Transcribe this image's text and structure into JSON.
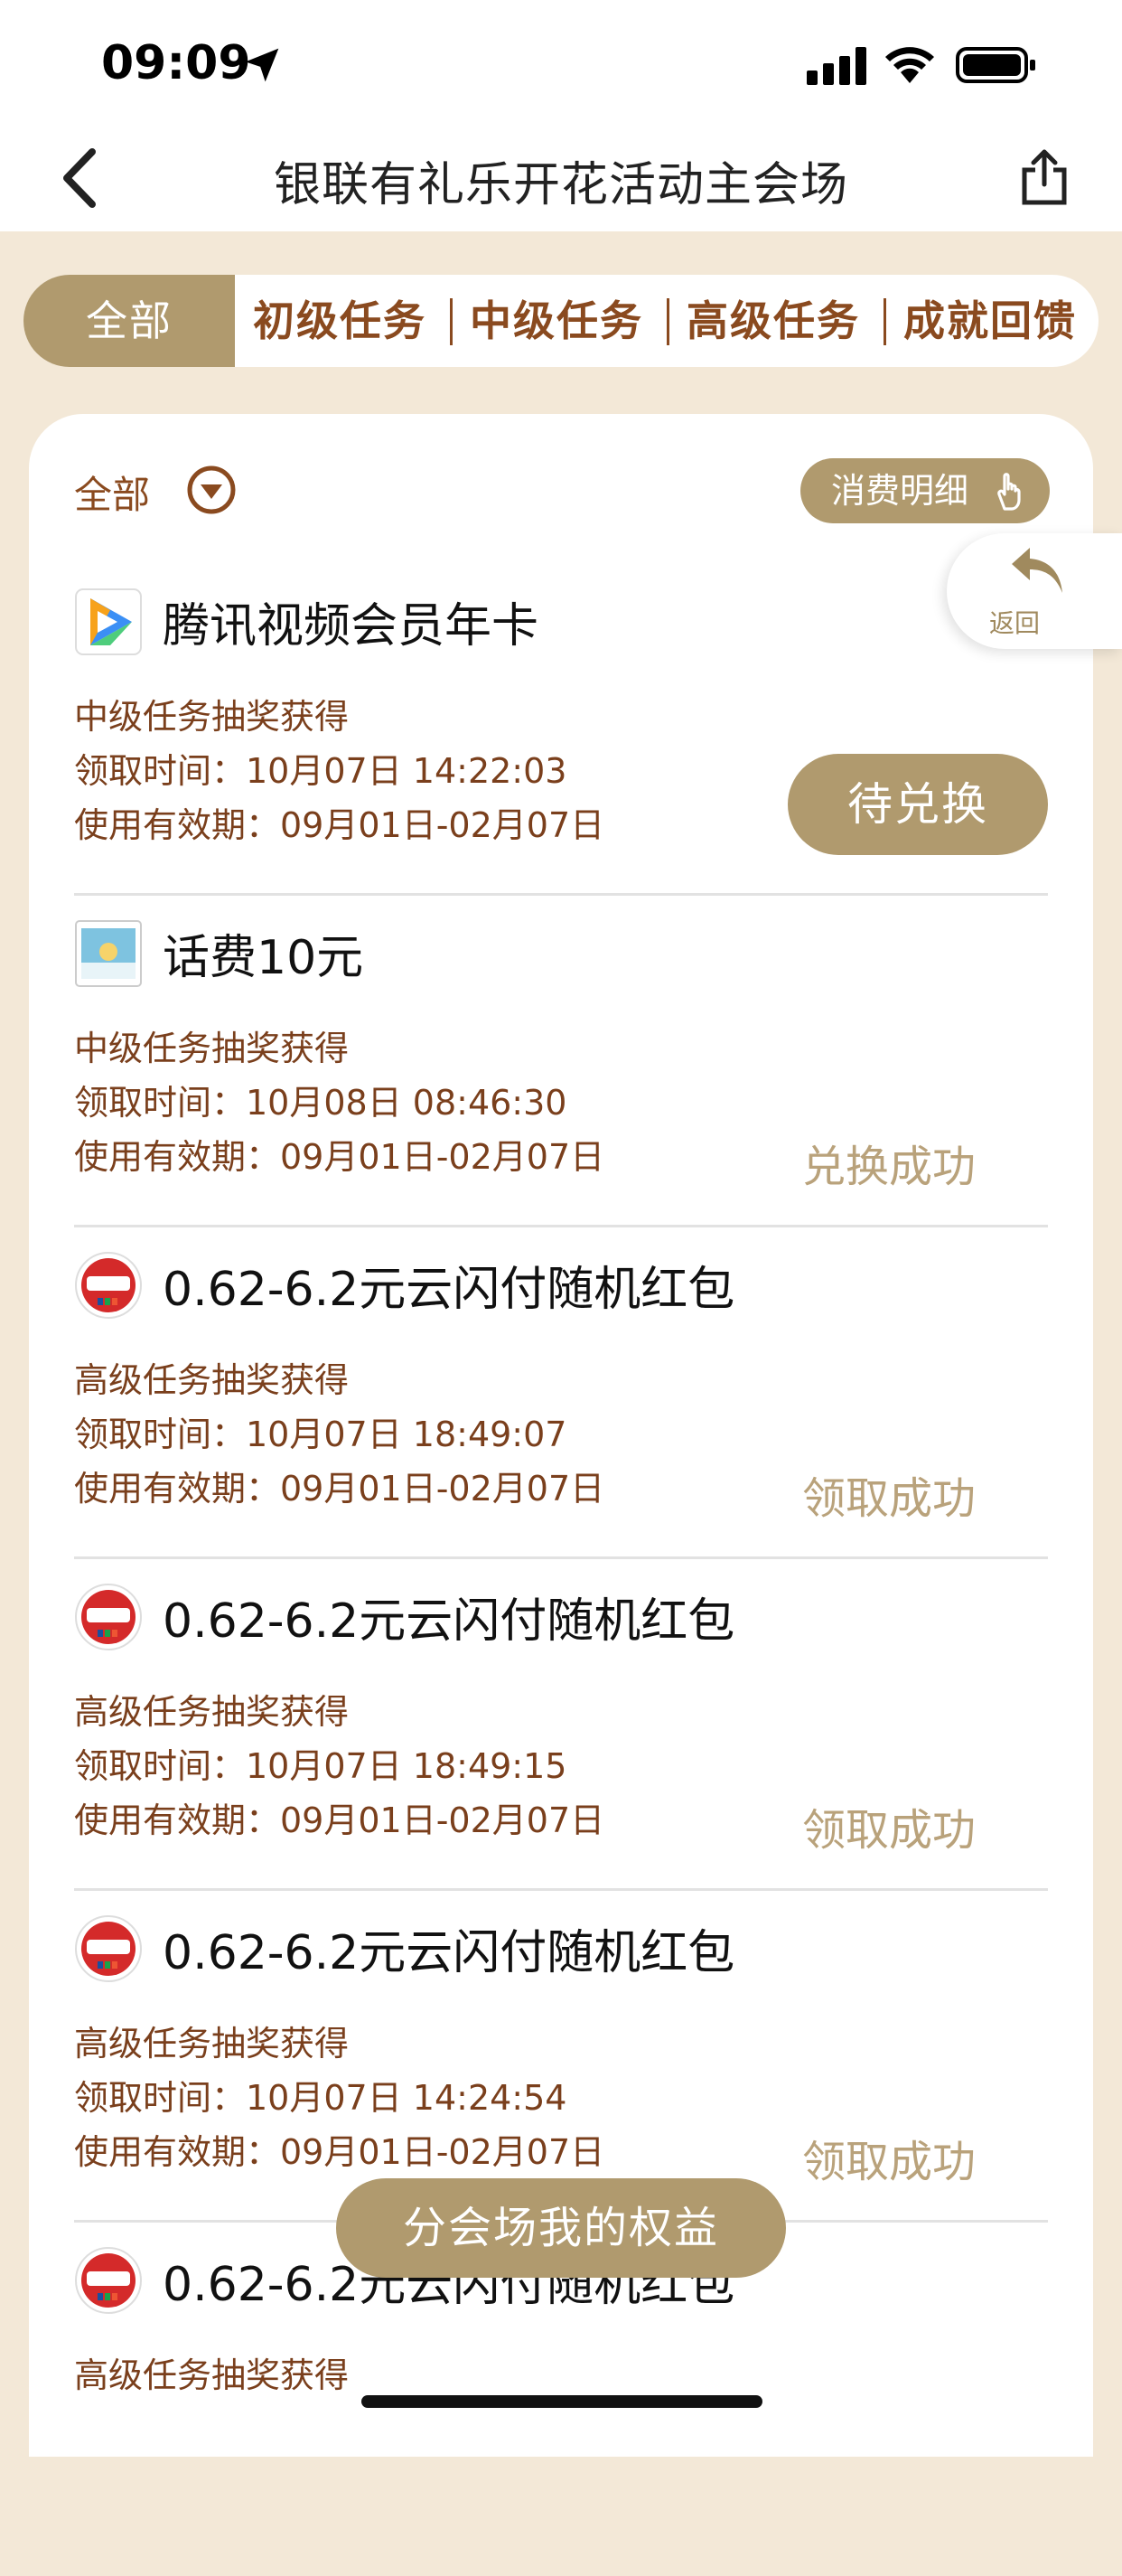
{
  "status_bar": {
    "time": "09:09"
  },
  "nav": {
    "title": "银联有礼乐开花活动主会场"
  },
  "tabs": [
    "全部",
    "初级任务",
    "中级任务",
    "高级任务",
    "成就回馈"
  ],
  "filter": {
    "label": "全部"
  },
  "detail_button": {
    "label": "消费明细"
  },
  "return_button": {
    "label": "返回"
  },
  "items": [
    {
      "icon": "tencent-video-logo-icon",
      "title": "腾讯视频会员年卡",
      "source": "中级任务抽奖获得",
      "claim_time": "领取时间：10月07日 14:22:03",
      "validity": "使用有效期：09月01日-02月07日",
      "action": "待兑换"
    },
    {
      "icon": "phone-credit-card-icon",
      "title": "话费10元",
      "source": "中级任务抽奖获得",
      "claim_time": "领取时间：10月08日 08:46:30",
      "validity": "使用有效期：09月01日-02月07日",
      "status": "兑换成功"
    },
    {
      "icon": "unionpay-logo-icon",
      "title": "0.62-6.2元云闪付随机红包",
      "source": "高级任务抽奖获得",
      "claim_time": "领取时间：10月07日 18:49:07",
      "validity": "使用有效期：09月01日-02月07日",
      "status": "领取成功"
    },
    {
      "icon": "unionpay-logo-icon",
      "title": "0.62-6.2元云闪付随机红包",
      "source": "高级任务抽奖获得",
      "claim_time": "领取时间：10月07日 18:49:15",
      "validity": "使用有效期：09月01日-02月07日",
      "status": "领取成功"
    },
    {
      "icon": "unionpay-logo-icon",
      "title": "0.62-6.2元云闪付随机红包",
      "source": "高级任务抽奖获得",
      "claim_time": "领取时间：10月07日 14:24:54",
      "validity": "使用有效期：09月01日-02月07日",
      "status": "领取成功"
    },
    {
      "icon": "unionpay-logo-icon",
      "title": "0.62-6.2元云闪付随机红包",
      "source": "高级任务抽奖获得"
    }
  ],
  "floating_button": {
    "label": "分会场我的权益"
  },
  "colors": {
    "accent": "#b09a6e",
    "brown_text": "#8a4a1f",
    "background": "#f3e8d7"
  }
}
